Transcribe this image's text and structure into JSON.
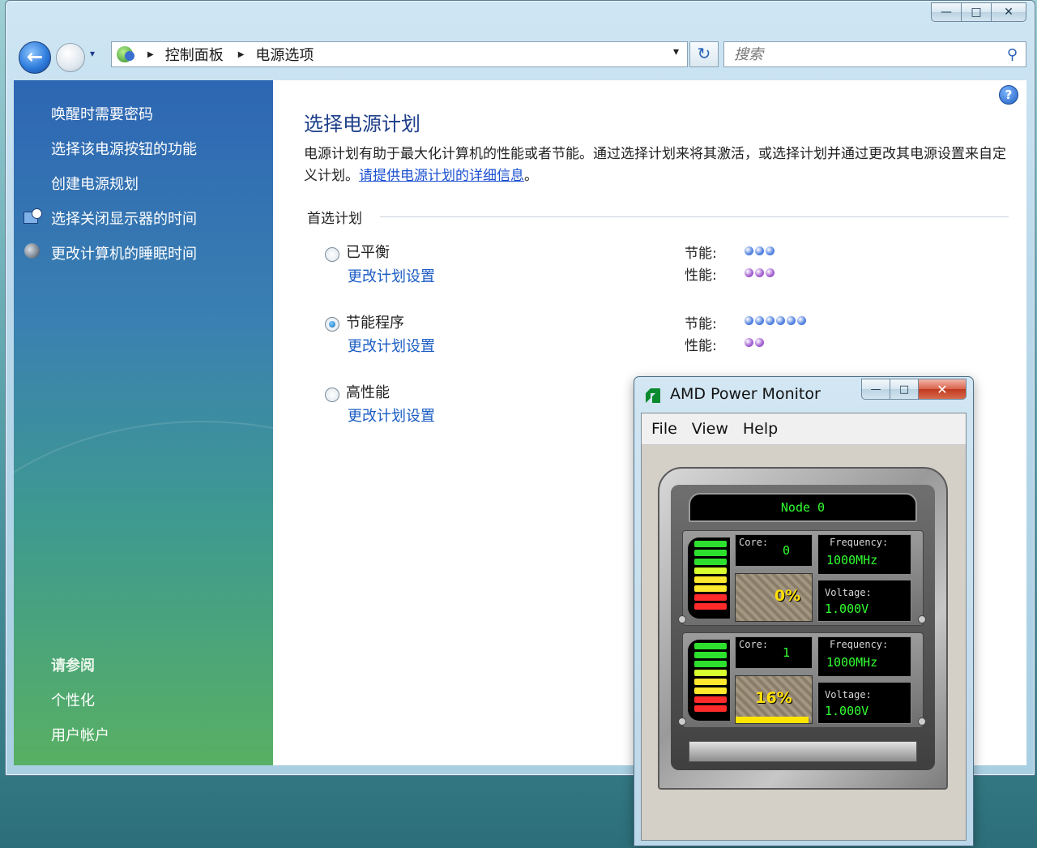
{
  "window": {
    "caption": {
      "minimize": "—",
      "maximize": "□",
      "close": "✕"
    }
  },
  "navbar": {
    "back_icon": "←",
    "breadcrumb": [
      "控制面板",
      "电源选项"
    ],
    "search_placeholder": "搜索",
    "refresh_icon": "↻",
    "dropdown_icon": "▾"
  },
  "sidebar": {
    "tasks": [
      "唤醒时需要密码",
      "选择该电源按钮的功能",
      "创建电源规划",
      "选择关闭显示器的时间",
      "更改计算机的睡眠时间"
    ],
    "see_also_title": "请参阅",
    "see_also": [
      "个性化",
      "用户帐户"
    ]
  },
  "content": {
    "title": "选择电源计划",
    "description": "电源计划有助于最大化计算机的性能或者节能。通过选择计划来将其激活，或选择计划并通过更改其电源设置来自定义计划。",
    "description_link": "请提供电源计划的详细信息",
    "description_end": "。",
    "group_title": "首选计划",
    "plans": [
      {
        "name": "已平衡",
        "link": "更改计划设置",
        "selected": false,
        "saving_label": "节能:",
        "perf_label": "性能:",
        "saving": 3,
        "performance": 3
      },
      {
        "name": "节能程序",
        "link": "更改计划设置",
        "selected": true,
        "saving_label": "节能:",
        "perf_label": "性能:",
        "saving": 6,
        "performance": 2
      },
      {
        "name": "高性能",
        "link": "更改计划设置",
        "selected": false
      }
    ],
    "help_icon": "?",
    "colors": {
      "saving_dot": "#4f7fe0",
      "perf_dot": "#a05cd0",
      "link": "#1a5cc4"
    }
  },
  "amd": {
    "title": "AMD Power Monitor",
    "caption": {
      "minimize": "—",
      "maximize": "□",
      "close": "✕"
    },
    "menu": [
      "File",
      "View",
      "Help"
    ],
    "node": "Node 0",
    "cores": [
      {
        "core_label": "Core:",
        "core": "0",
        "freq_label": "Frequency:",
        "frequency": "1000MHz",
        "volt_label": "Voltage:",
        "voltage": "1.000V",
        "load": "0%",
        "load_fraction": 0.0
      },
      {
        "core_label": "Core:",
        "core": "1",
        "freq_label": "Frequency:",
        "frequency": "1000MHz",
        "volt_label": "Voltage:",
        "voltage": "1.000V",
        "load": "16%",
        "load_fraction": 0.96
      }
    ]
  }
}
